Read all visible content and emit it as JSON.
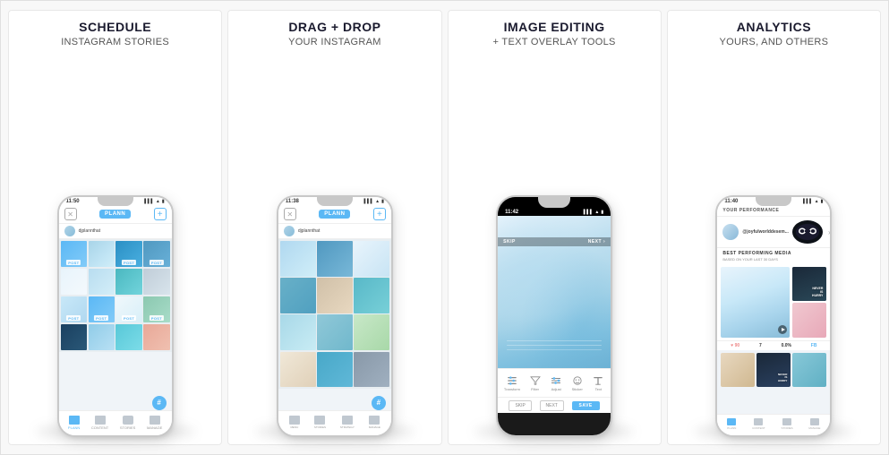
{
  "cards": [
    {
      "id": "schedule",
      "title": "SCHEDULE",
      "subtitle": "INSTAGRAM STORIES",
      "phone_time": "11:50",
      "app_name": "PLANN",
      "nav_items": [
        "PLANN",
        "CONTENT",
        "STORIES",
        "MANAGE"
      ],
      "nav_active": 0
    },
    {
      "id": "drag-drop",
      "title": "DRAG + DROP",
      "subtitle": "YOUR INSTAGRAM",
      "phone_time": "11:38",
      "app_name": "PLANN",
      "nav_items": [
        "MENU",
        "STORIES",
        "STRATEGY",
        "MANAGE"
      ],
      "nav_active": 0
    },
    {
      "id": "image-editing",
      "title": "IMAGE EDITING",
      "subtitle": "+ TEXT OVERLAY TOOLS",
      "phone_time": "11:42",
      "toolbar_items": [
        "Transform",
        "Filter",
        "Adjust",
        "Sticker",
        "Text"
      ],
      "bottom_btns": [
        "SKIP",
        "NEXT",
        "SAVE"
      ]
    },
    {
      "id": "analytics",
      "title": "ANALYTICS",
      "subtitle": "YOURS, AND OTHERS",
      "phone_time": "11:40",
      "header_text": "YOUR PERFORMANCE",
      "user_handle": "@joyfulworlddesem...",
      "best_performing_label": "BEST PERFORMING MEDIA",
      "based_on_label": "BASED ON YOUR LAST 30 DAYS",
      "stats": [
        {
          "val": "♥ 90",
          "label": ""
        },
        {
          "val": "7",
          "label": ""
        },
        {
          "val": "0.0%",
          "label": ""
        },
        {
          "val": "FB",
          "label": ""
        }
      ],
      "text_overlay_line1": "NEVER",
      "text_overlay_line2": "IS",
      "text_overlay_line3": "HURRY",
      "nav_items": [
        "PLANN",
        "CONTENT",
        "STORIES",
        "MANAGE"
      ]
    }
  ],
  "grid_colors": [
    "blue-mid",
    "photo-1",
    "blue-dark",
    "photo-2",
    "white",
    "blue-light",
    "teal",
    "gray",
    "photo-3",
    "blue-mid",
    "photo-4",
    "green",
    "dark-blue",
    "sky",
    "turq",
    "coral"
  ]
}
